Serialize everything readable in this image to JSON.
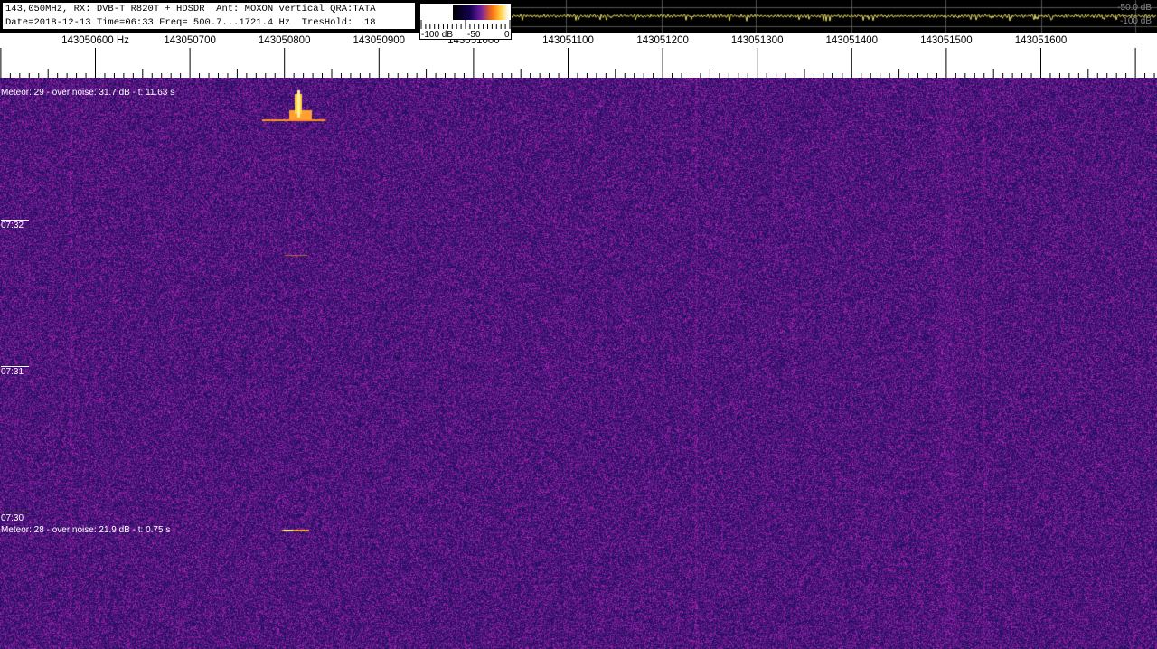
{
  "header": {
    "line1": "143,050MHz, RX: DVB-T R820T + HDSDR  Ant: MOXON vertical QRA:TATA",
    "line2": "Date=2018-12-13 Time=06:33 Freq= 500.7...1721.4 Hz  TresHold:  18"
  },
  "color_legend": {
    "labels": [
      "-100 dB",
      "-50",
      "0"
    ]
  },
  "spectrum": {
    "levels": [
      "-50.0 dB",
      "-100 dB"
    ],
    "trace_color": "#e8e060"
  },
  "ruler": {
    "labels": [
      "143050600 Hz",
      "143050700",
      "143050800",
      "143050900",
      "143051000",
      "143051100",
      "143051200",
      "143051300",
      "143051400",
      "143051500",
      "143051600"
    ]
  },
  "waterfall": {
    "meteors": [
      {
        "text": "Meteor: 29  - over noise: 31.7 dB -  t:  11.63 s"
      },
      {
        "text": "Meteor: 28  - over noise: 21.9 dB -  t:  0.75 s"
      }
    ],
    "times": [
      "07:32",
      "07:31",
      "07:30"
    ]
  }
}
